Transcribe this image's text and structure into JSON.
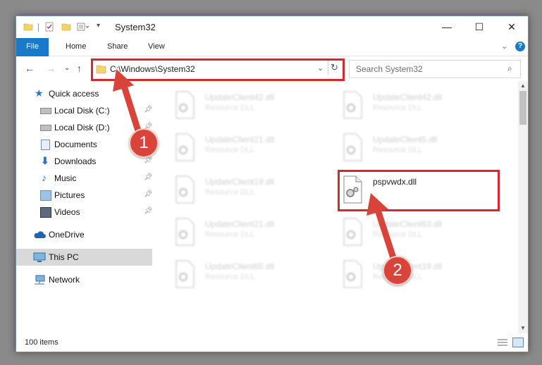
{
  "window": {
    "title": "System32",
    "controls": {
      "minimize": "—",
      "maximize": "☐",
      "close": "✕"
    }
  },
  "ribbon": {
    "tabs": [
      {
        "label": "File",
        "active": true
      },
      {
        "label": "Home"
      },
      {
        "label": "Share"
      },
      {
        "label": "View"
      }
    ],
    "help_icon": "?"
  },
  "address_bar": {
    "path": "C:\\Windows\\System32"
  },
  "search": {
    "placeholder": "Search System32"
  },
  "nav_pane": {
    "items": [
      {
        "label": "Quick access",
        "icon": "star-icon"
      },
      {
        "label": "Local Disk (C:)",
        "icon": "drive-icon",
        "pinned": true
      },
      {
        "label": "Local Disk (D:)",
        "icon": "drive-icon",
        "pinned": true
      },
      {
        "label": "Documents",
        "icon": "documents-icon",
        "pinned": true
      },
      {
        "label": "Downloads",
        "icon": "downloads-icon",
        "pinned": true
      },
      {
        "label": "Music",
        "icon": "music-icon",
        "pinned": true
      },
      {
        "label": "Pictures",
        "icon": "pictures-icon",
        "pinned": true
      },
      {
        "label": "Videos",
        "icon": "videos-icon",
        "pinned": true
      },
      {
        "label": "OneDrive",
        "icon": "onedrive-icon"
      },
      {
        "label": "This PC",
        "icon": "this-pc-icon",
        "selected": true
      },
      {
        "label": "Network",
        "icon": "network-icon"
      }
    ]
  },
  "files": [
    {
      "name": "UpdateClient42.dll",
      "desc": "Resource DLL",
      "highlighted": false
    },
    {
      "name": "UpdateClient42.dll",
      "desc": "Resource DLL",
      "highlighted": false
    },
    {
      "name": "UpdateClient21.dll",
      "desc": "Resource DLL",
      "highlighted": false
    },
    {
      "name": "UpdateClient5.dll",
      "desc": "Resource DLL",
      "highlighted": false
    },
    {
      "name": "UpdateClient19.dll",
      "desc": "Resource DLL",
      "highlighted": false
    },
    {
      "name": "pspvwdx.dll",
      "desc": "",
      "highlighted": true
    },
    {
      "name": "UpdateClient21.dll",
      "desc": "Resource DLL",
      "highlighted": false
    },
    {
      "name": "UpdateClient63.dll",
      "desc": "Resource DLL",
      "highlighted": false
    },
    {
      "name": "UpdateClient65.dll",
      "desc": "Resource DLL",
      "highlighted": false
    },
    {
      "name": "UpdateClient19.dll",
      "desc": "Resource DLL",
      "highlighted": false
    }
  ],
  "status_bar": {
    "item_count": "100 items"
  },
  "annotations": {
    "step1": "1",
    "step2": "2",
    "color": "#d9443a"
  }
}
